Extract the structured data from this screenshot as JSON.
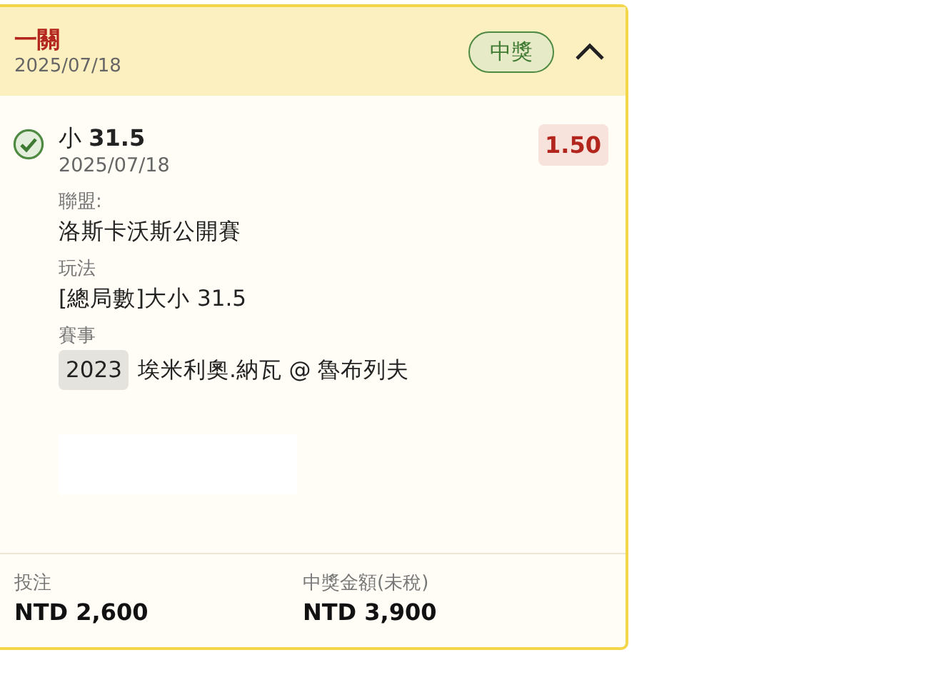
{
  "header": {
    "title": "一關",
    "date": "2025/07/18",
    "badge": "中獎",
    "expanded": true
  },
  "selection": {
    "won": true,
    "pick": "小 **31.5**",
    "date": "2025/07/18",
    "odds": "1.50"
  },
  "details": [
    {
      "label": "聯盟:",
      "value": "洛斯卡沃斯公開賽"
    },
    {
      "label": "玩法",
      "value": "[總局數]大小 31.5"
    },
    {
      "label": "賽事",
      "tag": "2023",
      "value": "埃米利奧.納瓦 @ 魯布列夫"
    }
  ],
  "footer": [
    {
      "label": "投注",
      "amount": "NTD 2,600"
    },
    {
      "label": "中獎金額(未稅)",
      "amount": "NTD 3,900"
    }
  ]
}
